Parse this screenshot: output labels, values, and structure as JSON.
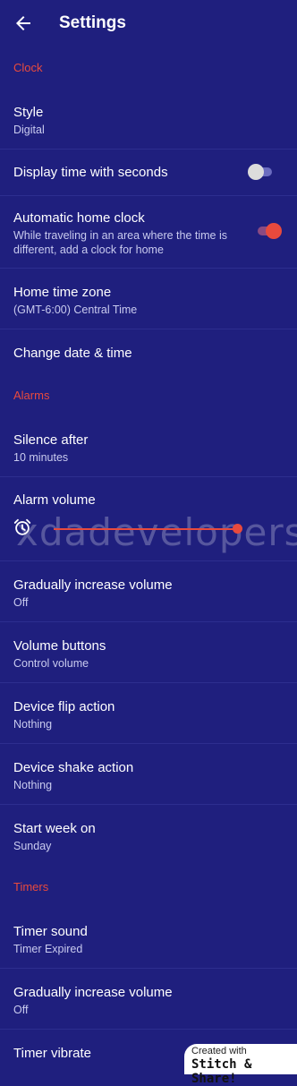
{
  "appbar": {
    "title": "Settings"
  },
  "sections": {
    "clock": "Clock",
    "alarms": "Alarms",
    "timers": "Timers"
  },
  "clock": {
    "style": {
      "label": "Style",
      "value": "Digital"
    },
    "display_seconds": {
      "label": "Display time with seconds",
      "checked": false
    },
    "auto_home": {
      "label": "Automatic home clock",
      "desc": "While traveling in an area where the time is different, add a clock for home",
      "checked": true
    },
    "home_zone": {
      "label": "Home time zone",
      "value": "(GMT-6:00) Central Time"
    },
    "change_date": {
      "label": "Change date & time"
    }
  },
  "alarms": {
    "silence": {
      "label": "Silence after",
      "value": "10 minutes"
    },
    "volume": {
      "label": "Alarm volume",
      "level": 0.97
    },
    "gradual": {
      "label": "Gradually increase volume",
      "value": "Off"
    },
    "buttons": {
      "label": "Volume buttons",
      "value": "Control volume"
    },
    "flip": {
      "label": "Device flip action",
      "value": "Nothing"
    },
    "shake": {
      "label": "Device shake action",
      "value": "Nothing"
    },
    "week": {
      "label": "Start week on",
      "value": "Sunday"
    }
  },
  "timers": {
    "sound": {
      "label": "Timer sound",
      "value": "Timer Expired"
    },
    "gradual": {
      "label": "Gradually increase volume",
      "value": "Off"
    },
    "vibrate": {
      "label": "Timer vibrate",
      "checked": false
    }
  },
  "watermark": "xdadevelopers",
  "badge": {
    "line1": "Created with",
    "line2": "Stitch & Share!"
  },
  "colors": {
    "background": "#1f1f7e",
    "accent": "#e84a3d"
  }
}
